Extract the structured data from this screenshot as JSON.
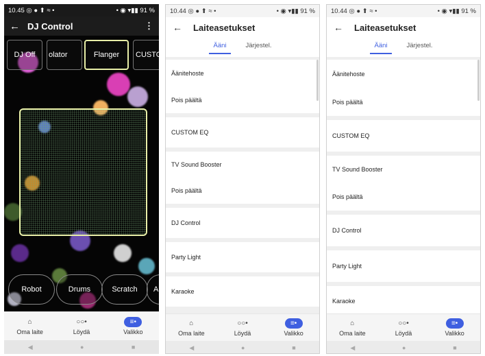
{
  "screens": {
    "dj": {
      "status_time": "10.45",
      "status_left_icons": "◎ ● ⬆ ≈ •",
      "status_right": "• ◉ ▾▮▮ 91 %",
      "title": "DJ Control",
      "back_glyph": "←",
      "more_glyph": "⋮",
      "effects": [
        "DJ Off",
        "olator",
        "Flanger",
        "CUSTO"
      ],
      "selected_effect": "Flanger",
      "sounds": [
        "Robot",
        "Drums",
        "Scratch",
        "A"
      ]
    },
    "settings_a": {
      "status_time": "10.44",
      "status_left_icons": "◎ ● ⬆ ≈ •",
      "status_right": "• ◉ ▾▮▮ 91 %",
      "title": "Laiteasetukset",
      "back_glyph": "←",
      "tabs": [
        "Ääni",
        "Järjestel."
      ],
      "active_tab": "Ääni"
    },
    "settings_b": {
      "status_time": "10.44",
      "status_left_icons": "◎ ● ⬆ ≈ •",
      "status_right": "• ◉ ▾▮▮ 91 %",
      "title": "Laiteasetukset",
      "back_glyph": "←",
      "tabs": [
        "Ääni",
        "Järjestel."
      ],
      "active_tab": "Ääni"
    }
  },
  "settings_items": {
    "sound_effect": "Äänitehoste",
    "sound_effect_value": "Pois päältä",
    "custom_eq": "CUSTOM EQ",
    "tv_booster": "TV Sound Booster",
    "tv_booster_value": "Pois päältä",
    "dj_control": "DJ Control",
    "party_light": "Party Light",
    "karaoke": "Karaoke"
  },
  "bottom_nav": {
    "items": [
      {
        "label": "Oma laite",
        "icon": "speaker-icon",
        "glyph": "⌂"
      },
      {
        "label": "Löydä",
        "icon": "discover-icon",
        "glyph": "○○•"
      },
      {
        "label": "Valikko",
        "icon": "menu-icon",
        "glyph": "≡•"
      }
    ],
    "active": "Valikko"
  },
  "system_nav": {
    "back": "◀",
    "home": "●",
    "recents": "■"
  },
  "colors": {
    "accent": "#3f5fe0",
    "pad_border": "#e9f0a8"
  }
}
